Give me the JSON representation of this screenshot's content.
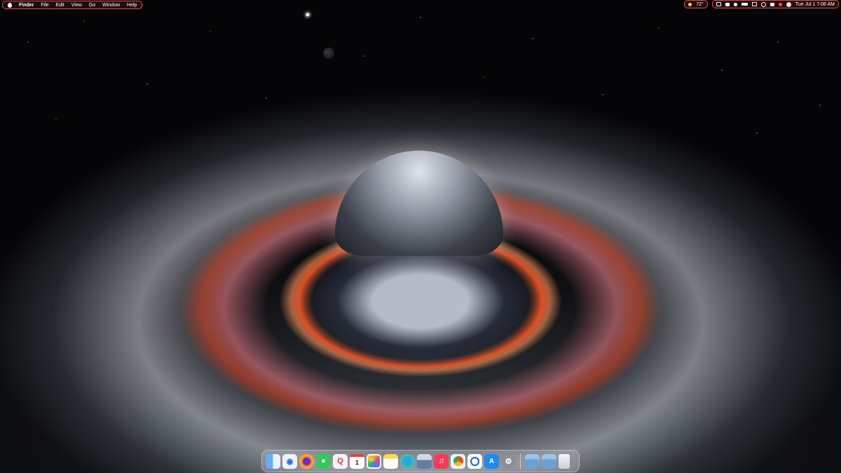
{
  "menubar": {
    "app_name": "Finder",
    "menus": [
      "File",
      "Edit",
      "View",
      "Go",
      "Window",
      "Help"
    ],
    "weather": "72°",
    "datetime": "Tue Jul 1  7:08 AM"
  },
  "dock": {
    "apps": [
      {
        "name": "Finder",
        "icon": "finder-icon",
        "color": "#3a8ef0"
      },
      {
        "name": "Safari",
        "icon": "compass-icon",
        "color": "#1f6fe0"
      },
      {
        "name": "Firefox",
        "icon": "firefox-icon",
        "color": "#ff7a1a"
      },
      {
        "name": "Messages",
        "icon": "messages-icon",
        "color": "#34c759"
      },
      {
        "name": "Search",
        "icon": "search-q-icon",
        "color": "#e8353f"
      },
      {
        "name": "Calendar",
        "icon": "calendar-icon",
        "color": "#ffffff"
      },
      {
        "name": "Photos",
        "icon": "photos-icon",
        "color": "#f2a33a"
      },
      {
        "name": "Notes",
        "icon": "notes-icon",
        "color": "#ffd65a"
      },
      {
        "name": "Edge",
        "icon": "edge-icon",
        "color": "#2aa7d8"
      },
      {
        "name": "Preview",
        "icon": "preview-icon",
        "color": "#5f7fa4"
      },
      {
        "name": "Music",
        "icon": "music-icon",
        "color": "#fa3a55"
      },
      {
        "name": "Chrome",
        "icon": "chrome-icon",
        "color": "#e5e5e5"
      },
      {
        "name": "1Password",
        "icon": "password-icon",
        "color": "#1466d6"
      },
      {
        "name": "App Store",
        "icon": "appstore-icon",
        "color": "#1d8cf0"
      },
      {
        "name": "System Settings",
        "icon": "gear-icon",
        "color": "#8e8e93"
      }
    ],
    "folders": [
      {
        "name": "Applications",
        "icon": "applications-folder-icon",
        "color": "#7fb0e0"
      },
      {
        "name": "Downloads",
        "icon": "downloads-folder-icon",
        "color": "#7fb0e0"
      },
      {
        "name": "Trash",
        "icon": "trash-icon",
        "color": "#d9dde2"
      }
    ],
    "glyphs": {
      "music-icon": "♫",
      "search-q-icon": "Q",
      "calendar-icon": "1",
      "gear-icon": "⚙",
      "compass-icon": "◉",
      "messages-icon": "●"
    }
  }
}
